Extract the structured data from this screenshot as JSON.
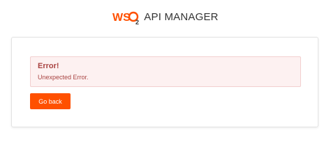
{
  "header": {
    "logo_icon": "wso2-logo",
    "logo_text": "WSO2",
    "product_name": "API MANAGER"
  },
  "colors": {
    "brand": "#ff5000",
    "error_text": "#a94442",
    "error_bg": "#fdf1f1",
    "error_border": "#f2cfcf"
  },
  "alert": {
    "title": "Error!",
    "message": "Unexpected Error."
  },
  "actions": {
    "go_back_label": "Go back"
  }
}
